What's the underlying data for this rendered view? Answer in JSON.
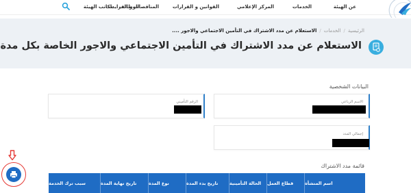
{
  "nav": {
    "items": [
      "عن الهيئة",
      "الخدمات",
      "المركز الإعلامي",
      "القوانين و القرارات",
      "المناقصات و المزايدات",
      "الوظائف",
      "مكاتب الهيئة"
    ]
  },
  "breadcrumb": {
    "home": "الرئيسية",
    "services": "الخدمات",
    "current": "الاستعلام عن مدد الاشتراك في التأمين الاجتماعي والاجور ....",
    "separator": "/"
  },
  "page": {
    "title": "الاستعلام عن مدد الاشتراك في التأمين الاجتماعي والاجور الخاصة بكل مدة"
  },
  "personal_info": {
    "heading": "البيانات الشخصية",
    "insurance_number_label": "الرقم التأميني",
    "full_name_label": "الاسم الرباعي",
    "total_period_label": "إجمالي المدد"
  },
  "periods": {
    "heading": "قائمة مدد الاشتراك",
    "columns": [
      "اسم المنشأة",
      "قطاع العمل",
      "الحالة التأمينية",
      "تاريخ بدء المدة",
      "نوع المدة",
      "تاريخ نهاية المدة",
      "سبب ترك الخدمة"
    ]
  },
  "colors": {
    "primary": "#1f6cc4",
    "accent": "#39aedf",
    "annotation": "#e53935",
    "hero_bg": "#edf1f5"
  },
  "icons": {
    "search": "search-icon",
    "title": "document-check-icon",
    "print": "print-icon",
    "annotation": "down-arrow-icon",
    "logo": "logo"
  }
}
